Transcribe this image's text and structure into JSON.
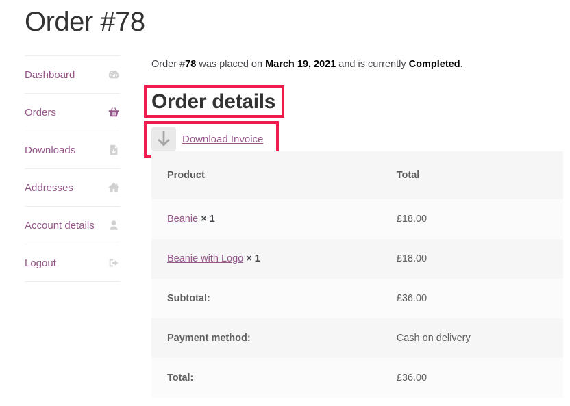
{
  "page": {
    "title": "Order #78"
  },
  "sidebar": {
    "items": [
      {
        "label": "Dashboard",
        "icon": "dashboard-icon"
      },
      {
        "label": "Orders",
        "icon": "basket-icon"
      },
      {
        "label": "Downloads",
        "icon": "file-download-icon"
      },
      {
        "label": "Addresses",
        "icon": "home-icon"
      },
      {
        "label": "Account details",
        "icon": "user-icon"
      },
      {
        "label": "Logout",
        "icon": "logout-icon"
      }
    ],
    "active": "Orders"
  },
  "summary": {
    "prefix": "Order #",
    "order_number": "78",
    "middle": " was placed on ",
    "date": "March 19, 2021",
    "middle2": " and is currently ",
    "status": "Completed",
    "suffix": "."
  },
  "order_details": {
    "heading": "Order details",
    "download_invoice": "Download Invoice",
    "columns": [
      "Product",
      "Total"
    ],
    "items": [
      {
        "name": "Beanie",
        "qty": "× 1",
        "total": "£18.00"
      },
      {
        "name": "Beanie with Logo",
        "qty": "× 1",
        "total": "£18.00"
      }
    ],
    "totals": [
      {
        "label": "Subtotal:",
        "value": "£36.00"
      },
      {
        "label": "Payment method:",
        "value": "Cash on delivery"
      },
      {
        "label": "Total:",
        "value": "£36.00"
      }
    ]
  },
  "colors": {
    "accent": "#96588a",
    "highlight": "#ef1b4c",
    "icon": "#d1d1d1"
  }
}
